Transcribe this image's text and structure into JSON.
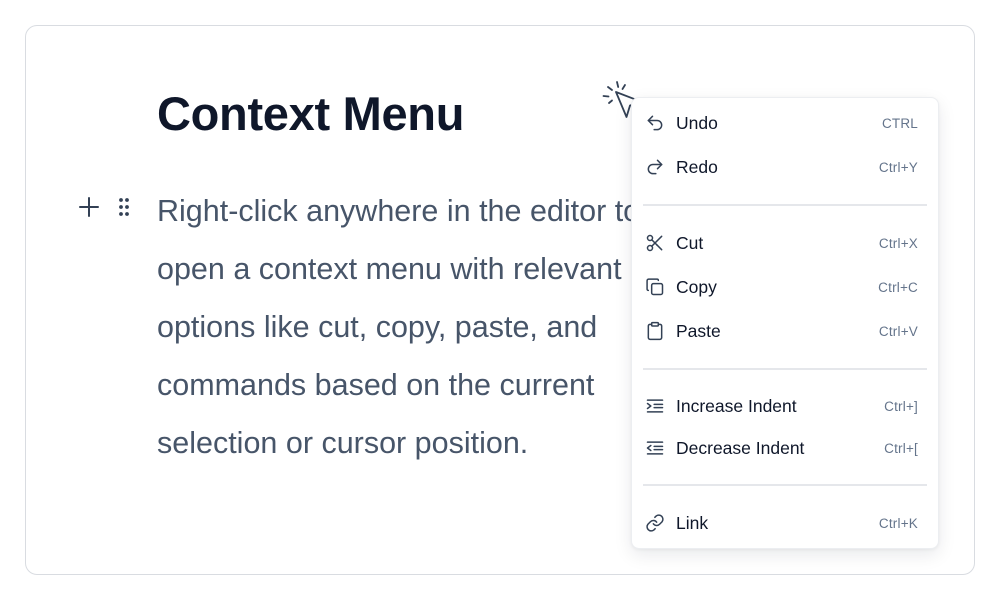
{
  "document": {
    "title": "Context Menu",
    "paragraph_lines": [
      "Right-click anywhere in the editor to",
      "open a context menu with relevant",
      "options like cut, copy, paste, and",
      "commands based on the current",
      "selection or cursor position."
    ]
  },
  "context_menu": {
    "items": [
      {
        "label": "Undo",
        "shortcut": "CTRL",
        "icon": "undo-icon"
      },
      {
        "label": "Redo",
        "shortcut": "Ctrl+Y",
        "icon": "redo-icon"
      },
      {
        "label": "Cut",
        "shortcut": "Ctrl+X",
        "icon": "scissors-icon"
      },
      {
        "label": "Copy",
        "shortcut": "Ctrl+C",
        "icon": "copy-icon"
      },
      {
        "label": "Paste",
        "shortcut": "Ctrl+V",
        "icon": "clipboard-icon"
      },
      {
        "label": "Increase Indent",
        "shortcut": "Ctrl+]",
        "icon": "indent-increase-icon"
      },
      {
        "label": "Decrease Indent",
        "shortcut": "Ctrl+[",
        "icon": "indent-decrease-icon"
      },
      {
        "label": "Link",
        "shortcut": "Ctrl+K",
        "icon": "link-icon"
      }
    ]
  },
  "colors": {
    "title": "#0f172a",
    "body_text": "#475569",
    "shortcut_text": "#64748b",
    "border": "#d9dce1",
    "separator": "#e5e7eb"
  }
}
